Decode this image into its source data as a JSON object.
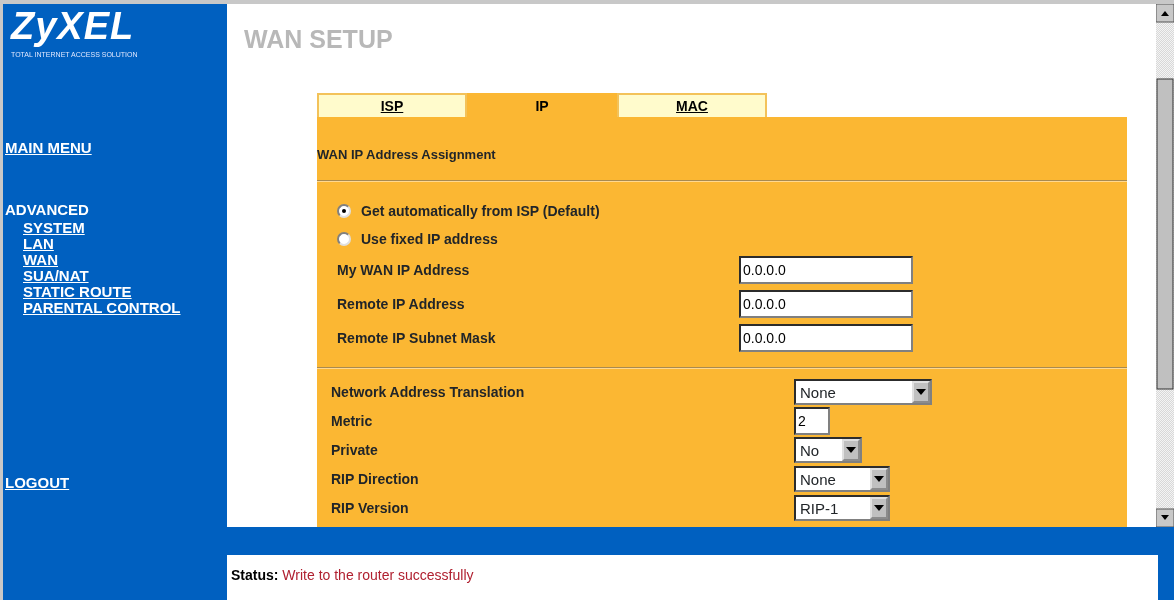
{
  "logo": {
    "brand": "ZyXEL",
    "tagline": "TOTAL INTERNET ACCESS SOLUTION"
  },
  "sidebar": {
    "main_menu": "MAIN MENU",
    "section": "ADVANCED",
    "items": [
      {
        "label": "SYSTEM"
      },
      {
        "label": "LAN"
      },
      {
        "label": "WAN"
      },
      {
        "label": "SUA/NAT"
      },
      {
        "label": "STATIC ROUTE"
      },
      {
        "label": "PARENTAL CONTROL"
      }
    ],
    "logout": "LOGOUT"
  },
  "page_title": "WAN SETUP",
  "tabs": [
    {
      "label": "ISP",
      "selected": false
    },
    {
      "label": "IP",
      "selected": true
    },
    {
      "label": "MAC",
      "selected": false
    }
  ],
  "section_heading": "WAN IP Address Assignment",
  "radios": [
    {
      "label": "Get automatically from ISP (Default)",
      "selected": true
    },
    {
      "label": "Use fixed IP address",
      "selected": false
    }
  ],
  "fields": [
    {
      "label": "My WAN IP Address",
      "value": "0.0.0.0"
    },
    {
      "label": "Remote IP Address",
      "value": "0.0.0.0"
    },
    {
      "label": "Remote IP Subnet Mask",
      "value": "0.0.0.0"
    }
  ],
  "settings": [
    {
      "label": "Network Address Translation",
      "kind": "select",
      "value": "None"
    },
    {
      "label": "Metric",
      "kind": "input",
      "value": "2"
    },
    {
      "label": "Private",
      "kind": "select",
      "value": "No"
    },
    {
      "label": "RIP Direction",
      "kind": "select",
      "value": "None"
    },
    {
      "label": "RIP Version",
      "kind": "select",
      "value": "RIP-1"
    }
  ],
  "status": {
    "label": "Status:",
    "message": "Write to the router successfully"
  }
}
